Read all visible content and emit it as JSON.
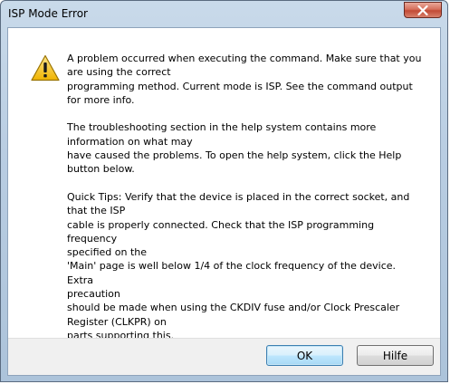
{
  "window": {
    "title": "ISP Mode Error"
  },
  "message": {
    "paragraph1": "A problem occurred when executing the command. Make sure that you\nare using the correct\nprogramming method. Current mode is ISP. See the command output\nfor more info.",
    "paragraph2": "The troubleshooting section in the help system contains more\ninformation on what may\nhave caused the problems. To open the help system, click the Help\nbutton below.",
    "paragraph3": "Quick Tips: Verify that the device is placed in the correct socket, and\nthat the ISP\ncable is properly connected. Check that the ISP programming frequency\nspecified on the\n'Main' page is well below 1/4 of the clock frequency of the device. Extra\nprecaution\nshould be made when using the CKDIV fuse and/or Clock Prescaler\nRegister (CLKPR) on\nparts supporting this."
  },
  "buttons": {
    "ok_label": "OK",
    "help_label": "Hilfe"
  },
  "icons": {
    "warning": "warning-icon",
    "close": "close-icon"
  },
  "colors": {
    "warning_fill": "#f5c518",
    "close_button": "#c7503c"
  }
}
